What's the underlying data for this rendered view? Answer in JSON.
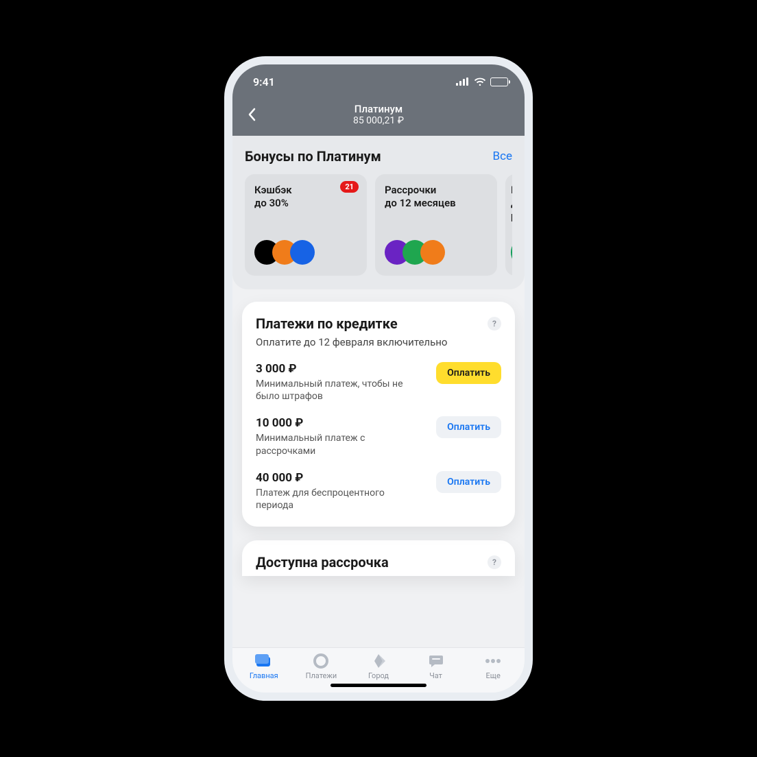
{
  "status": {
    "time": "9:41"
  },
  "header": {
    "title": "Платинум",
    "balance": "85 000,21 ₽"
  },
  "bonuses": {
    "title": "Бонусы по Платинум",
    "all": "Все",
    "cards": [
      {
        "line1": "Кэшбэк",
        "line2": "до 30%",
        "badge": "21",
        "dots": [
          "c-black",
          "c-orange",
          "c-blue"
        ]
      },
      {
        "line1": "Рассрочки",
        "line2": "до 12 месяцев",
        "dots": [
          "c-purple",
          "c-green",
          "c-orange"
        ]
      },
      {
        "line1": "К",
        "line2": "д",
        "line3": "р",
        "dots": [
          "c-green2"
        ]
      }
    ]
  },
  "payments": {
    "title": "Платежи по кредитке",
    "subtitle": "Оплатите до 12 февраля включительно",
    "rows": [
      {
        "amount": "3 000 ₽",
        "desc": "Минимальный платеж, чтобы не было штрафов",
        "btn": "Оплатить",
        "style": "primary"
      },
      {
        "amount": "10 000 ₽",
        "desc": "Минимальный платеж с рассрочками",
        "btn": "Оплатить",
        "style": "secondary"
      },
      {
        "amount": "40 000 ₽",
        "desc": "Платеж для беспроцентного периода",
        "btn": "Оплатить",
        "style": "secondary"
      }
    ]
  },
  "installment": {
    "title": "Доступна рассрочка"
  },
  "tabs": {
    "items": [
      {
        "label": "Главная",
        "active": true,
        "icon": "card"
      },
      {
        "label": "Платежи",
        "icon": "circle"
      },
      {
        "label": "Город",
        "icon": "diamond"
      },
      {
        "label": "Чат",
        "icon": "chat"
      },
      {
        "label": "Еще",
        "icon": "dots"
      }
    ]
  }
}
